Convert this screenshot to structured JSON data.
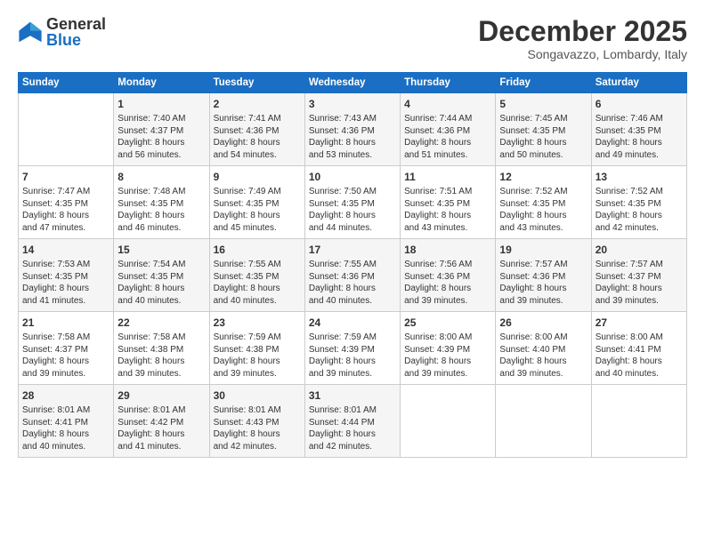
{
  "logo": {
    "general": "General",
    "blue": "Blue"
  },
  "header": {
    "month": "December 2025",
    "location": "Songavazzo, Lombardy, Italy"
  },
  "weekdays": [
    "Sunday",
    "Monday",
    "Tuesday",
    "Wednesday",
    "Thursday",
    "Friday",
    "Saturday"
  ],
  "weeks": [
    [
      {
        "day": "",
        "content": ""
      },
      {
        "day": "1",
        "content": "Sunrise: 7:40 AM\nSunset: 4:37 PM\nDaylight: 8 hours\nand 56 minutes."
      },
      {
        "day": "2",
        "content": "Sunrise: 7:41 AM\nSunset: 4:36 PM\nDaylight: 8 hours\nand 54 minutes."
      },
      {
        "day": "3",
        "content": "Sunrise: 7:43 AM\nSunset: 4:36 PM\nDaylight: 8 hours\nand 53 minutes."
      },
      {
        "day": "4",
        "content": "Sunrise: 7:44 AM\nSunset: 4:36 PM\nDaylight: 8 hours\nand 51 minutes."
      },
      {
        "day": "5",
        "content": "Sunrise: 7:45 AM\nSunset: 4:35 PM\nDaylight: 8 hours\nand 50 minutes."
      },
      {
        "day": "6",
        "content": "Sunrise: 7:46 AM\nSunset: 4:35 PM\nDaylight: 8 hours\nand 49 minutes."
      }
    ],
    [
      {
        "day": "7",
        "content": "Sunrise: 7:47 AM\nSunset: 4:35 PM\nDaylight: 8 hours\nand 47 minutes."
      },
      {
        "day": "8",
        "content": "Sunrise: 7:48 AM\nSunset: 4:35 PM\nDaylight: 8 hours\nand 46 minutes."
      },
      {
        "day": "9",
        "content": "Sunrise: 7:49 AM\nSunset: 4:35 PM\nDaylight: 8 hours\nand 45 minutes."
      },
      {
        "day": "10",
        "content": "Sunrise: 7:50 AM\nSunset: 4:35 PM\nDaylight: 8 hours\nand 44 minutes."
      },
      {
        "day": "11",
        "content": "Sunrise: 7:51 AM\nSunset: 4:35 PM\nDaylight: 8 hours\nand 43 minutes."
      },
      {
        "day": "12",
        "content": "Sunrise: 7:52 AM\nSunset: 4:35 PM\nDaylight: 8 hours\nand 43 minutes."
      },
      {
        "day": "13",
        "content": "Sunrise: 7:52 AM\nSunset: 4:35 PM\nDaylight: 8 hours\nand 42 minutes."
      }
    ],
    [
      {
        "day": "14",
        "content": "Sunrise: 7:53 AM\nSunset: 4:35 PM\nDaylight: 8 hours\nand 41 minutes."
      },
      {
        "day": "15",
        "content": "Sunrise: 7:54 AM\nSunset: 4:35 PM\nDaylight: 8 hours\nand 40 minutes."
      },
      {
        "day": "16",
        "content": "Sunrise: 7:55 AM\nSunset: 4:35 PM\nDaylight: 8 hours\nand 40 minutes."
      },
      {
        "day": "17",
        "content": "Sunrise: 7:55 AM\nSunset: 4:36 PM\nDaylight: 8 hours\nand 40 minutes."
      },
      {
        "day": "18",
        "content": "Sunrise: 7:56 AM\nSunset: 4:36 PM\nDaylight: 8 hours\nand 39 minutes."
      },
      {
        "day": "19",
        "content": "Sunrise: 7:57 AM\nSunset: 4:36 PM\nDaylight: 8 hours\nand 39 minutes."
      },
      {
        "day": "20",
        "content": "Sunrise: 7:57 AM\nSunset: 4:37 PM\nDaylight: 8 hours\nand 39 minutes."
      }
    ],
    [
      {
        "day": "21",
        "content": "Sunrise: 7:58 AM\nSunset: 4:37 PM\nDaylight: 8 hours\nand 39 minutes."
      },
      {
        "day": "22",
        "content": "Sunrise: 7:58 AM\nSunset: 4:38 PM\nDaylight: 8 hours\nand 39 minutes."
      },
      {
        "day": "23",
        "content": "Sunrise: 7:59 AM\nSunset: 4:38 PM\nDaylight: 8 hours\nand 39 minutes."
      },
      {
        "day": "24",
        "content": "Sunrise: 7:59 AM\nSunset: 4:39 PM\nDaylight: 8 hours\nand 39 minutes."
      },
      {
        "day": "25",
        "content": "Sunrise: 8:00 AM\nSunset: 4:39 PM\nDaylight: 8 hours\nand 39 minutes."
      },
      {
        "day": "26",
        "content": "Sunrise: 8:00 AM\nSunset: 4:40 PM\nDaylight: 8 hours\nand 39 minutes."
      },
      {
        "day": "27",
        "content": "Sunrise: 8:00 AM\nSunset: 4:41 PM\nDaylight: 8 hours\nand 40 minutes."
      }
    ],
    [
      {
        "day": "28",
        "content": "Sunrise: 8:01 AM\nSunset: 4:41 PM\nDaylight: 8 hours\nand 40 minutes."
      },
      {
        "day": "29",
        "content": "Sunrise: 8:01 AM\nSunset: 4:42 PM\nDaylight: 8 hours\nand 41 minutes."
      },
      {
        "day": "30",
        "content": "Sunrise: 8:01 AM\nSunset: 4:43 PM\nDaylight: 8 hours\nand 42 minutes."
      },
      {
        "day": "31",
        "content": "Sunrise: 8:01 AM\nSunset: 4:44 PM\nDaylight: 8 hours\nand 42 minutes."
      },
      {
        "day": "",
        "content": ""
      },
      {
        "day": "",
        "content": ""
      },
      {
        "day": "",
        "content": ""
      }
    ]
  ]
}
